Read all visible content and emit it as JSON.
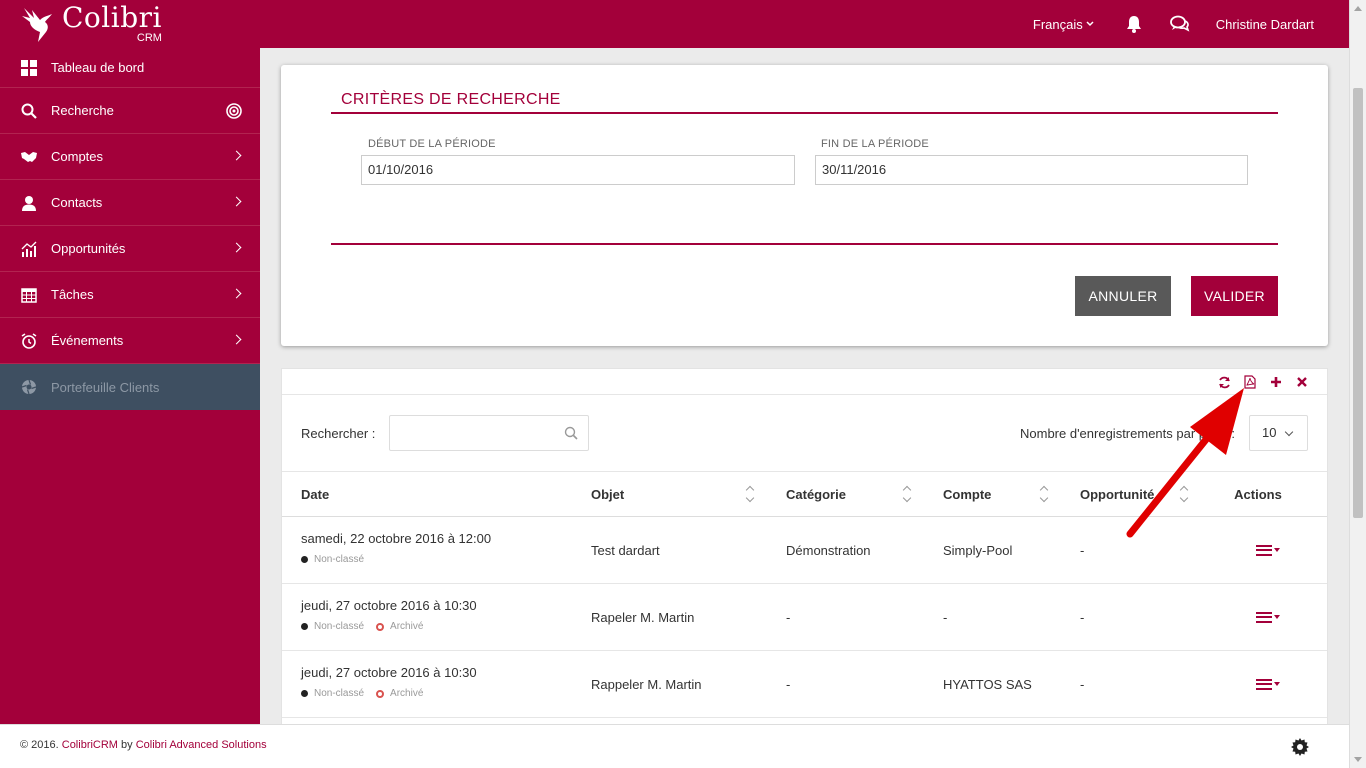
{
  "brand": {
    "name": "Colibri",
    "sub": "CRM"
  },
  "topbar": {
    "language": "Français",
    "user": "Christine Dardart"
  },
  "sidebar": {
    "items": [
      {
        "label": "Tableau de bord"
      },
      {
        "label": "Recherche"
      },
      {
        "label": "Comptes"
      },
      {
        "label": "Contacts"
      },
      {
        "label": "Opportunités"
      },
      {
        "label": "Tâches"
      },
      {
        "label": "Événements"
      },
      {
        "label": "Portefeuille Clients"
      }
    ]
  },
  "criteria": {
    "title": "CRITÈRES DE RECHERCHE",
    "start_label": "DÉBUT DE LA PÉRIODE",
    "start_value": "01/10/2016",
    "end_label": "FIN DE LA PÉRIODE",
    "end_value": "30/11/2016",
    "cancel_label": "ANNULER",
    "ok_label": "VALIDER"
  },
  "table": {
    "search_label": "Rechercher :",
    "length_label": "Nombre d'enregistrements par page :",
    "length_value": "10",
    "columns": [
      "Date",
      "Objet",
      "Catégorie",
      "Compte",
      "Opportunité",
      "Actions"
    ],
    "rows": [
      {
        "date": "samedi, 22 octobre 2016 à 12:00",
        "tag1": "Non-classé",
        "tag2": "",
        "objet": "Test dardart",
        "categorie": "Démonstration",
        "compte": "Simply-Pool",
        "opportunite": "-"
      },
      {
        "date": "jeudi, 27 octobre 2016 à 10:30",
        "tag1": "Non-classé",
        "tag2": "Archivé",
        "objet": "Rapeler M. Martin",
        "categorie": "-",
        "compte": "-",
        "opportunite": "-"
      },
      {
        "date": "jeudi, 27 octobre 2016 à 10:30",
        "tag1": "Non-classé",
        "tag2": "Archivé",
        "objet": "Rappeler M. Martin",
        "categorie": "-",
        "compte": "HYATTOS SAS",
        "opportunite": "-"
      }
    ]
  },
  "footer": {
    "prefix": "© 2016. ",
    "product": "ColibriCRM",
    "by": " by ",
    "company": "Colibri Advanced Solutions"
  },
  "colors": {
    "brand": "#a3003a",
    "sidebar_active": "#3e4f61",
    "cancel_button": "#595959",
    "annotation_arrow": "#e00000"
  }
}
